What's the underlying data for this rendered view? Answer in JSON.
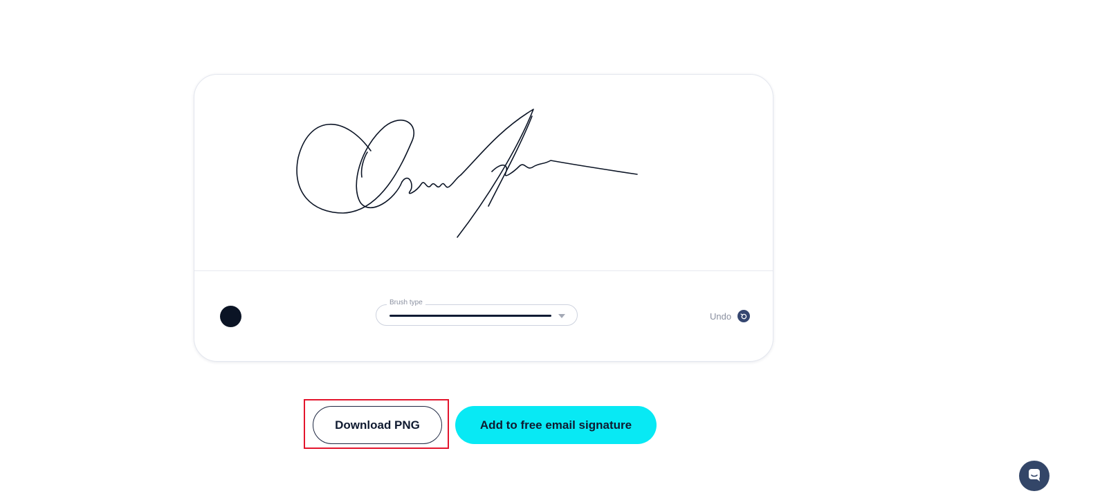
{
  "toolbar": {
    "brush_type_label": "Brush type",
    "undo_label": "Undo",
    "brush_color": "#0b1425"
  },
  "actions": {
    "download_label": "Download PNG",
    "add_signature_label": "Add to free email signature"
  },
  "colors": {
    "accent": "#08e9f4",
    "highlight": "#e3142c",
    "dark": "#0f1a30",
    "chat": "#334668"
  },
  "icons": {
    "undo": "undo-icon",
    "chat": "chat-icon"
  }
}
